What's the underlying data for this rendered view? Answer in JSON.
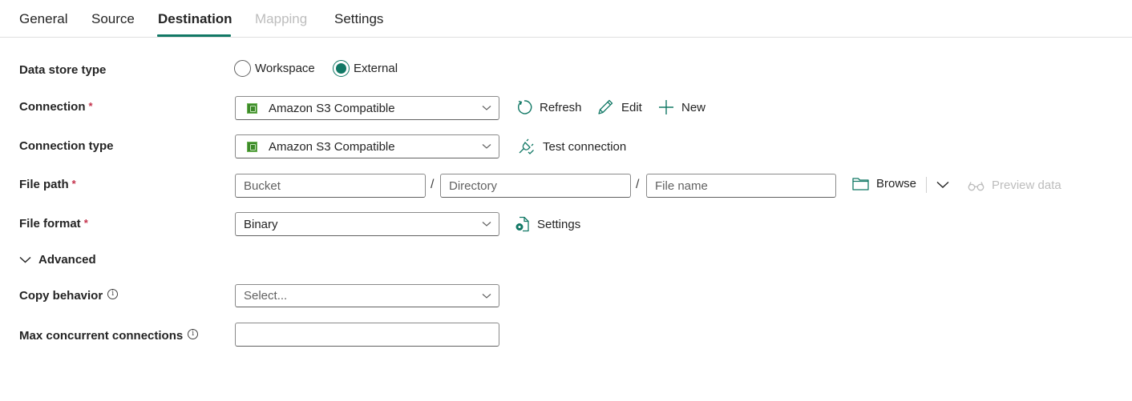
{
  "tabs": [
    {
      "label": "General",
      "state": "normal"
    },
    {
      "label": "Source",
      "state": "normal"
    },
    {
      "label": "Destination",
      "state": "active"
    },
    {
      "label": "Mapping",
      "state": "disabled"
    },
    {
      "label": "Settings",
      "state": "normal"
    }
  ],
  "accent_color": "#117865",
  "form": {
    "data_store_type": {
      "label": "Data store type",
      "options": [
        {
          "label": "Workspace",
          "checked": false
        },
        {
          "label": "External",
          "checked": true
        }
      ]
    },
    "connection": {
      "label": "Connection",
      "required_mark": "*",
      "value": "Amazon S3 Compatible",
      "icon": "amazon-s3-icon",
      "actions": {
        "refresh": "Refresh",
        "edit": "Edit",
        "new": "New"
      }
    },
    "connection_type": {
      "label": "Connection type",
      "value": "Amazon S3 Compatible",
      "icon": "amazon-s3-icon",
      "test_connection": "Test connection"
    },
    "file_path": {
      "label": "File path",
      "required_mark": "*",
      "bucket_placeholder": "Bucket",
      "directory_placeholder": "Directory",
      "file_name_placeholder": "File name",
      "separator": "/",
      "browse": "Browse",
      "preview_data": "Preview data"
    },
    "file_format": {
      "label": "File format",
      "required_mark": "*",
      "value": "Binary",
      "settings": "Settings"
    },
    "advanced": {
      "label": "Advanced",
      "expanded": true
    },
    "copy_behavior": {
      "label": "Copy behavior",
      "info": "i",
      "placeholder": "Select..."
    },
    "max_concurrent_connections": {
      "label": "Max concurrent connections",
      "info": "i",
      "value": ""
    }
  }
}
